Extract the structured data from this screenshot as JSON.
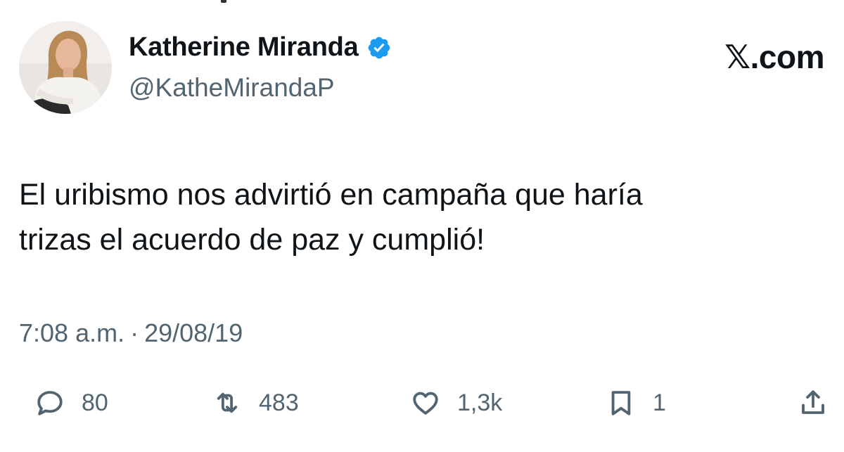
{
  "author": {
    "display_name": "Katherine Miranda",
    "handle": "@KatheMirandaP",
    "verified": true,
    "verified_color": "#1d9bf0"
  },
  "brand": {
    "label": "𝕏.com"
  },
  "tweet": {
    "lines": [
      "El uribismo nos advirtió en campaña que haría",
      "trizas el acuerdo de paz y cumplió!"
    ]
  },
  "meta": {
    "time": "7:08 a.m.",
    "separator": "·",
    "date": "29/08/19"
  },
  "actions": {
    "replies": "80",
    "reposts": "483",
    "likes": "1,3k",
    "bookmarks": "1"
  },
  "icons": {
    "reply": "reply-icon",
    "repost": "repost-icon",
    "like": "heart-icon",
    "bookmark": "bookmark-icon",
    "share": "share-icon"
  },
  "colors": {
    "text": "#0f1419",
    "secondary": "#536471",
    "background": "#ffffff"
  }
}
